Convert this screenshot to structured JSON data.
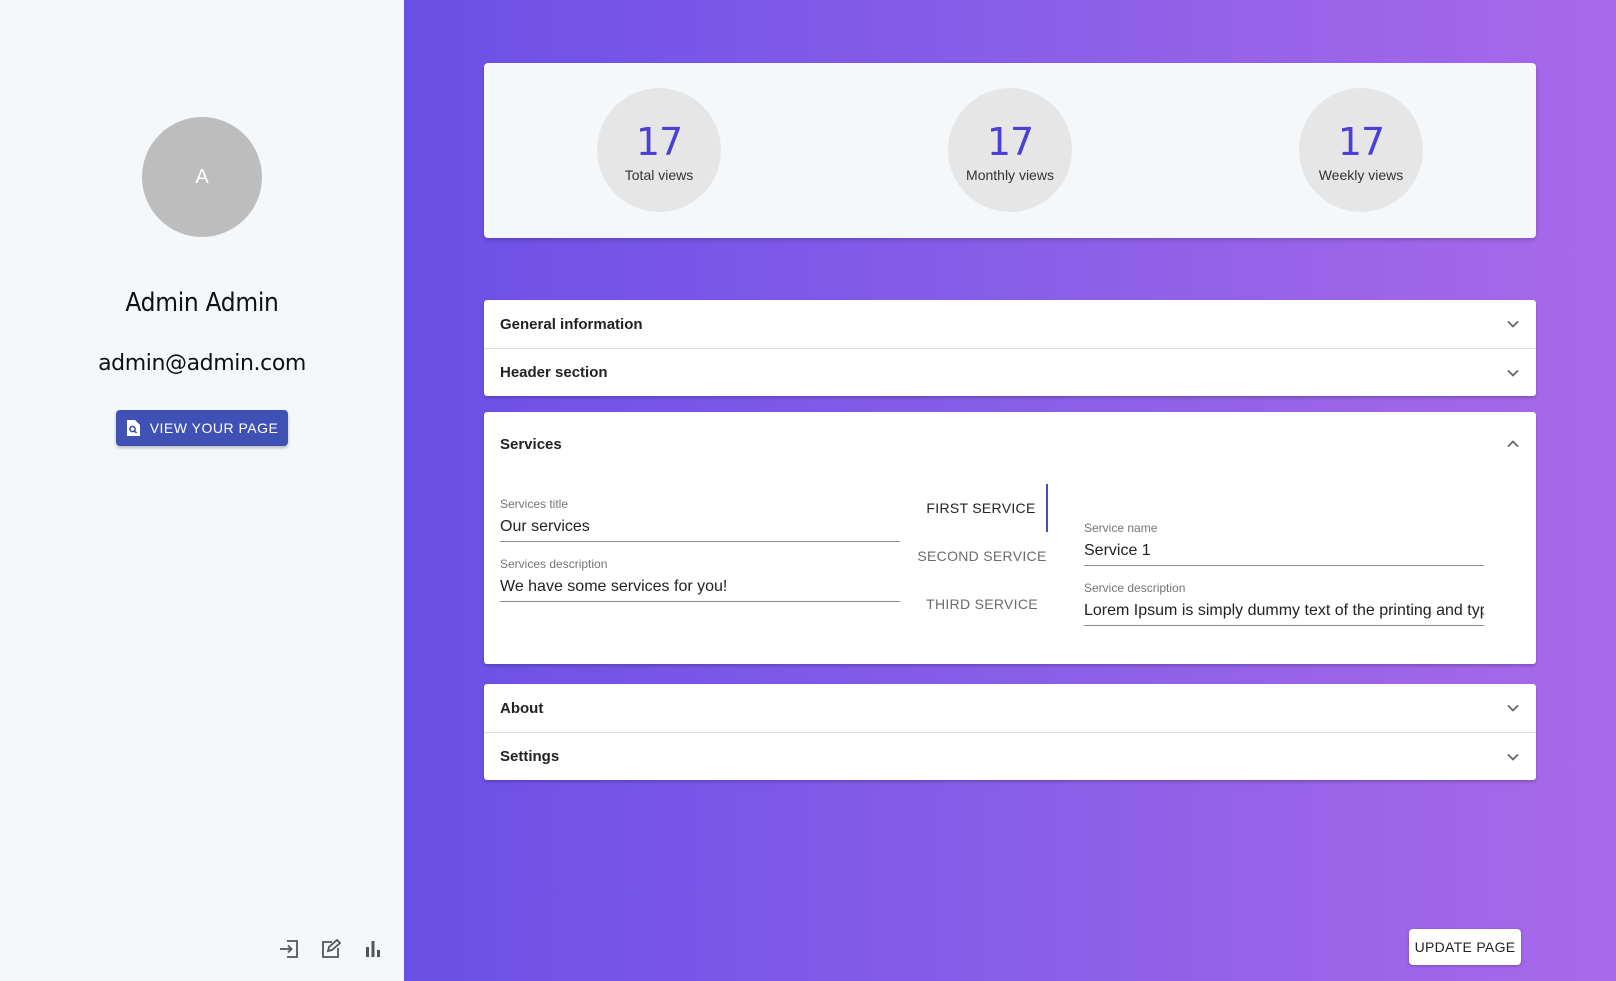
{
  "user": {
    "avatar_initial": "A",
    "name": "Admin Admin",
    "email": "admin@admin.com",
    "view_page_label": "VIEW YOUR PAGE"
  },
  "sidebar_tools": [
    {
      "icon": "logout-icon"
    },
    {
      "icon": "edit-icon"
    },
    {
      "icon": "bar-chart-icon"
    }
  ],
  "stats": [
    {
      "value": "17",
      "label": "Total views"
    },
    {
      "value": "17",
      "label": "Monthly views"
    },
    {
      "value": "17",
      "label": "Weekly views"
    }
  ],
  "panels": {
    "general": "General information",
    "header": "Header section",
    "services": "Services",
    "about": "About",
    "settings": "Settings"
  },
  "services": {
    "title_label": "Services title",
    "title_value": "Our services",
    "description_label": "Services description",
    "description_value": "We have some services for you!",
    "tabs": [
      "FIRST SERVICE",
      "SECOND SERVICE",
      "THIRD SERVICE"
    ],
    "active_tab": 0,
    "service_name_label": "Service name",
    "service_name_value": "Service 1",
    "service_description_label": "Service description",
    "service_description_value": "Lorem Ipsum is simply dummy text of the printing and typesetting industry."
  },
  "update_label": "UPDATE PAGE",
  "colors": {
    "accent": "#3f51b5",
    "stat_value": "#4b3fd6",
    "sidebar_bg": "#f5f8fb",
    "gradient_start": "#6a50e6",
    "gradient_end": "#a969ea"
  }
}
